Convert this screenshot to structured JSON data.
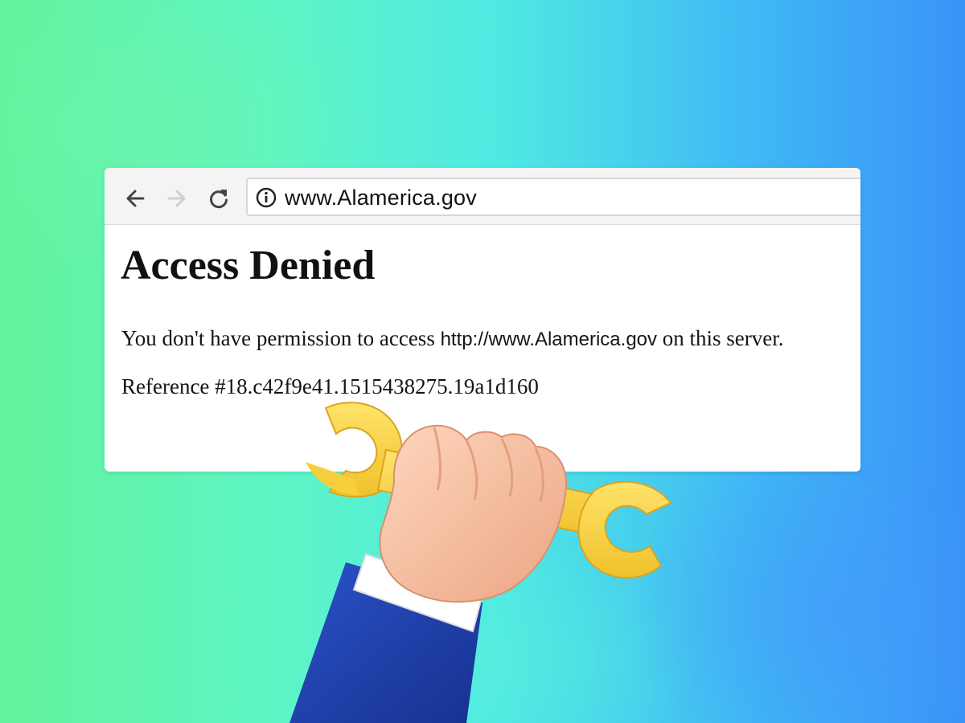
{
  "browser": {
    "address_bar": {
      "url": "www.Alamerica.gov"
    }
  },
  "page": {
    "heading": "Access Denied",
    "message": {
      "prefix": "You don't have permission to access ",
      "url": "http://www.Alamerica.gov",
      "suffix": " on this server."
    },
    "reference": "Reference #18.c42f9e41.1515438275.19a1d160"
  },
  "icons": {
    "back": "arrow-left-icon",
    "forward": "arrow-right-icon",
    "reload": "reload-icon",
    "site_info": "info-icon",
    "illustration": "hand-holding-wrench"
  },
  "colors": {
    "background_left": "#62f29b",
    "background_right": "#3a93f8",
    "wrench": "#f7d443",
    "sleeve": "#1f3fa8",
    "hand": "#f7c2a2"
  }
}
